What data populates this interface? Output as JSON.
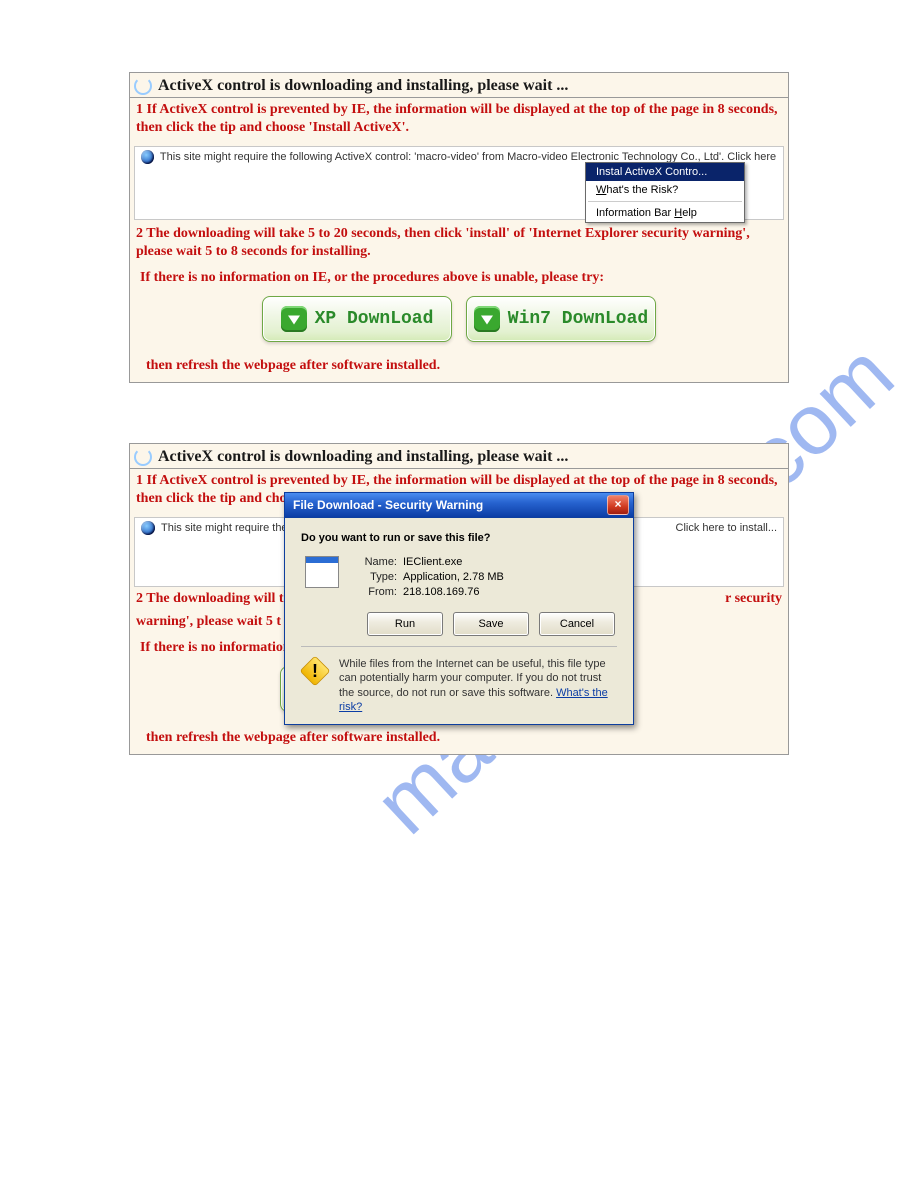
{
  "watermark": "manualshive.com",
  "panel1": {
    "title": "ActiveX control is downloading and installing,   please wait ...",
    "para1": "1 If ActiveX control is prevented by IE,   the information will be displayed at the top of   the page in 8 seconds,   then click the tip and choose   'Install ActiveX'.",
    "infobar": "This site might require the following ActiveX control: 'macro-video' from Macro-video Electronic Technology Co., Ltd'. Click here to install...",
    "menu": {
      "install": "Instal ActiveX Contro...",
      "risk": "What's the Risk?",
      "help": "Information Bar Help"
    },
    "para2": "2 The downloading will take 5 to 20 seconds,   then click   'install'   of  'Internet Explorer security warning',   please wait 5 to 8 seconds for installing.",
    "para3": "If there is no information on IE,   or the procedures above is unable,   please try:",
    "btn_xp": "XP DownLoad",
    "btn_win7": "Win7 DownLoad",
    "para4": "then refresh the webpage after software installed."
  },
  "panel2": {
    "title": "ActiveX control is downloading and installing,   please wait ...",
    "para1": "1 If ActiveX control is prevented by IE,   the information will be displayed at the top of   the page in 8 seconds,   then click the tip and choose   'Install ActiveX'.",
    "infobar_left": "This site might require the follo",
    "infobar_right": "Click here to install...",
    "para2_left": "2 The downloading will ta",
    "para2_right": "r security",
    "para2b_left": "warning',   please wait 5 t",
    "para3_left": "If there is no information",
    "para4": "then refresh the webpage after software installed."
  },
  "dialog": {
    "title": "File Download - Security Warning",
    "question": "Do you want to run or save this file?",
    "name_k": "Name:",
    "name_v": "IEClient.exe",
    "type_k": "Type:",
    "type_v": "Application, 2.78 MB",
    "from_k": "From:",
    "from_v": "218.108.169.76",
    "run": "Run",
    "save": "Save",
    "cancel": "Cancel",
    "warn": "While files from the Internet can be useful, this file type can potentially harm your computer. If you do not trust the source, do not run or save this software. ",
    "warn_link": "What's the risk?"
  }
}
